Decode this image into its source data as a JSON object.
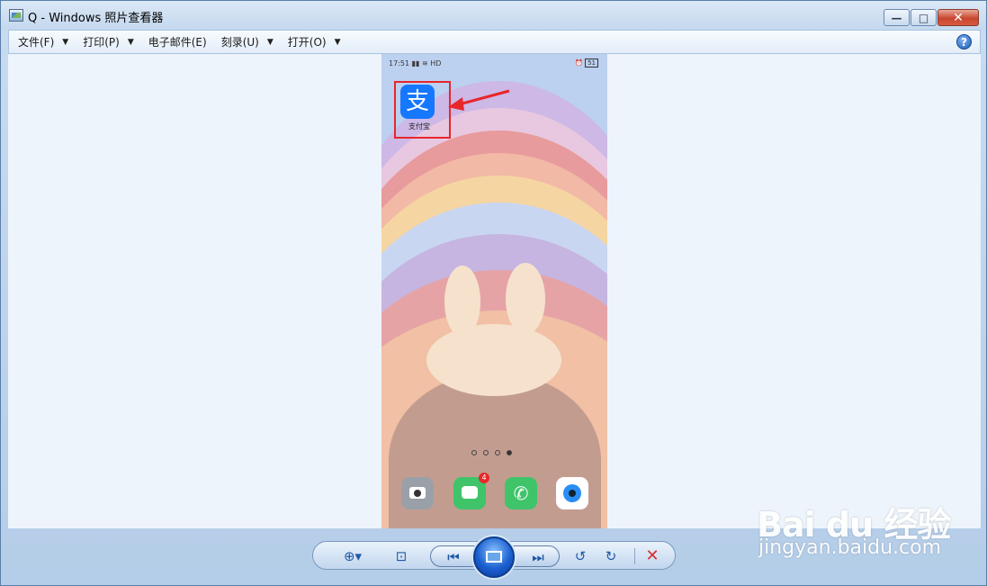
{
  "window": {
    "title": "Q - Windows 照片查看器",
    "controls": {
      "minimize": "—",
      "maximize": "□",
      "close": "✕"
    }
  },
  "menubar": {
    "items": [
      {
        "label": "文件(F)",
        "has_dropdown": true
      },
      {
        "label": "打印(P)",
        "has_dropdown": true
      },
      {
        "label": "电子邮件(E)",
        "has_dropdown": false
      },
      {
        "label": "刻录(U)",
        "has_dropdown": true
      },
      {
        "label": "打开(O)",
        "has_dropdown": true
      }
    ],
    "help_label": "?"
  },
  "photo": {
    "status_time": "17:51",
    "status_signal": "HD",
    "status_battery": "51",
    "highlighted_app": {
      "label": "支付宝",
      "glyph": "支"
    },
    "page_dots": 4,
    "active_page_dot": 4,
    "dock_apps": [
      "camera",
      "messages",
      "phone",
      "browser"
    ],
    "messages_badge": "4"
  },
  "toolbar": {
    "zoom": "zoom-icon",
    "fit": "actual-size-icon",
    "previous": "previous-icon",
    "slideshow": "slideshow-icon",
    "next": "next-icon",
    "rotate_ccw": "rotate-counterclockwise-icon",
    "rotate_cw": "rotate-clockwise-icon",
    "delete": "delete-icon"
  },
  "watermark": {
    "brand": "Bai du 经验",
    "url": "jingyan.baidu.com"
  },
  "colors": {
    "highlight_box": "#e8262b",
    "alipay_blue": "#1677ff",
    "delete_red": "#d83030"
  }
}
